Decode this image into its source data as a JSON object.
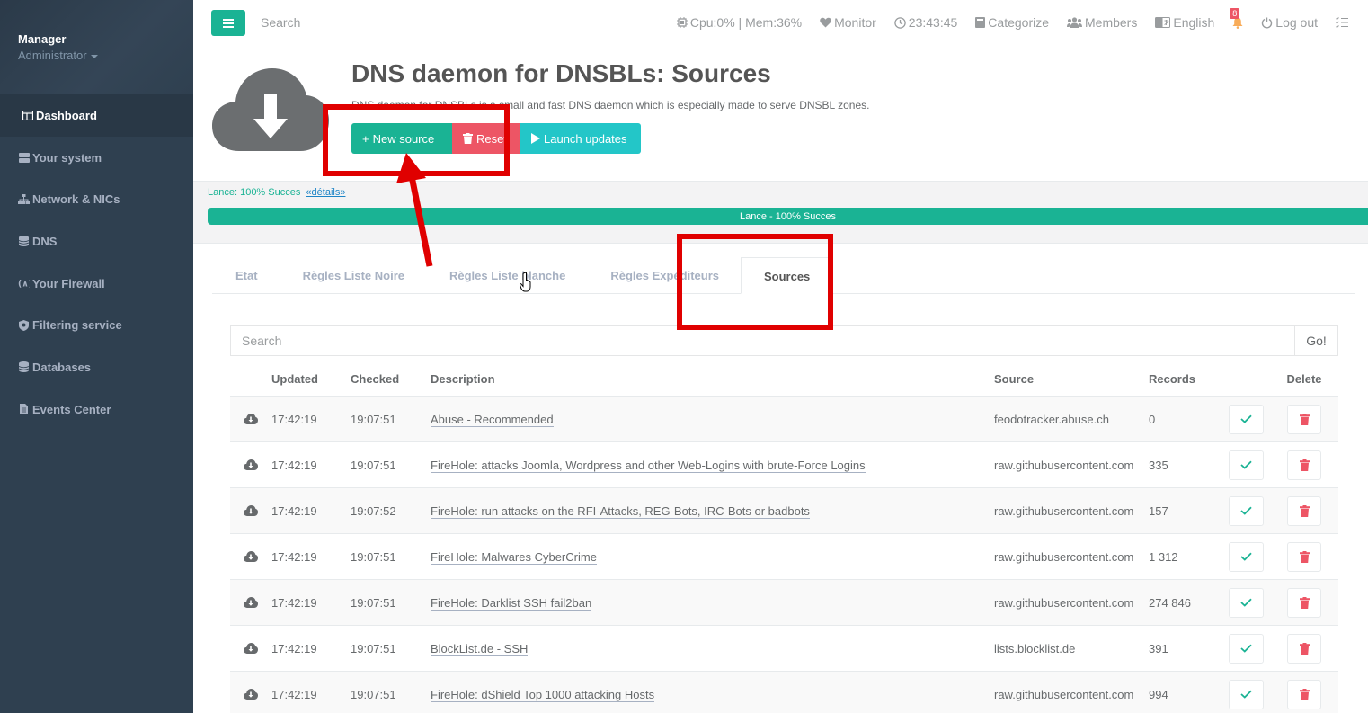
{
  "sidebar": {
    "user_name": "Manager",
    "user_role": "Administrator",
    "items": [
      {
        "label": "Dashboard",
        "icon": "dashboard-icon"
      },
      {
        "label": "Your system",
        "icon": "server-icon"
      },
      {
        "label": "Network & NICs",
        "icon": "sitemap-icon"
      },
      {
        "label": "DNS",
        "icon": "database-icon"
      },
      {
        "label": "Your Firewall",
        "icon": "firewall-icon"
      },
      {
        "label": "Filtering service",
        "icon": "shield-icon"
      },
      {
        "label": "Databases",
        "icon": "database-icon"
      },
      {
        "label": "Events Center",
        "icon": "file-icon"
      }
    ]
  },
  "topbar": {
    "search_placeholder": "Search",
    "cpu_mem": "Cpu:0% | Mem:36%",
    "monitor": "Monitor",
    "clock": "23:43:45",
    "categorize": "Categorize",
    "members": "Members",
    "language": "English",
    "notifications": "8",
    "logout": "Log out"
  },
  "header": {
    "title": "DNS daemon for DNSBLs: Sources",
    "description": "DNS daemon for DNSBLs is a small and fast DNS daemon which is especially made to serve DNSBL zones.",
    "new_source": "New source",
    "reset": "Reset",
    "launch_updates": "Launch updates"
  },
  "progress": {
    "label": "Lance: 100% Succes",
    "details_link": "«détails»",
    "bar_text": "Lance - 100% Succes",
    "percent": 100
  },
  "tabs": [
    {
      "label": "Etat"
    },
    {
      "label": "Règles Liste Noire"
    },
    {
      "label": "Règles Liste blanche"
    },
    {
      "label": "Règles Expéditeurs"
    },
    {
      "label": "Sources",
      "active": true
    }
  ],
  "search": {
    "placeholder": "Search",
    "go_label": "Go!"
  },
  "table": {
    "columns": [
      "Updated",
      "Checked",
      "Description",
      "Source",
      "Records",
      "Delete"
    ],
    "rows": [
      {
        "updated": "17:42:19",
        "checked": "19:07:51",
        "description": "Abuse - Recommended",
        "source": "feodotracker.abuse.ch",
        "records": "0"
      },
      {
        "updated": "17:42:19",
        "checked": "19:07:51",
        "description": "FireHole: attacks Joomla, Wordpress and other Web-Logins with brute-Force Logins",
        "source": "raw.githubusercontent.com",
        "records": "335"
      },
      {
        "updated": "17:42:19",
        "checked": "19:07:52",
        "description": "FireHole: run attacks on the RFI-Attacks, REG-Bots, IRC-Bots or badbots",
        "source": "raw.githubusercontent.com",
        "records": "157"
      },
      {
        "updated": "17:42:19",
        "checked": "19:07:51",
        "description": "FireHole: Malwares CyberCrime",
        "source": "raw.githubusercontent.com",
        "records": "1 312"
      },
      {
        "updated": "17:42:19",
        "checked": "19:07:51",
        "description": "FireHole: Darklist SSH fail2ban",
        "source": "raw.githubusercontent.com",
        "records": "274 846"
      },
      {
        "updated": "17:42:19",
        "checked": "19:07:51",
        "description": "BlockList.de - SSH",
        "source": "lists.blocklist.de",
        "records": "391"
      },
      {
        "updated": "17:42:19",
        "checked": "19:07:51",
        "description": "FireHole: dShield Top 1000 attacking Hosts",
        "source": "raw.githubusercontent.com",
        "records": "994"
      }
    ]
  },
  "colors": {
    "accent": "#1ab394",
    "danger": "#ed5565",
    "info": "#23c6c8",
    "sidebar": "#2f4050",
    "annotation": "#e00000"
  }
}
